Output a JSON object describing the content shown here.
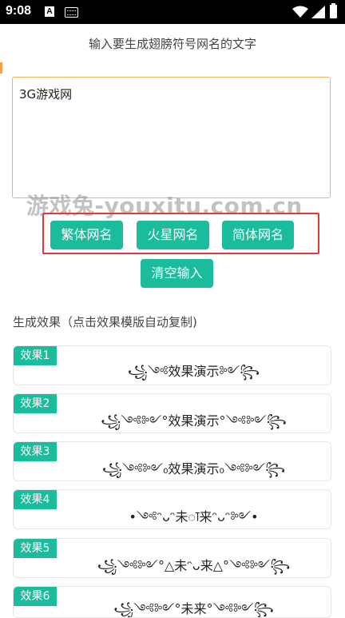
{
  "status_bar": {
    "time": "9:08",
    "icons": [
      "notification-a-icon",
      "keyboard-icon",
      "wifi-icon",
      "signal-icon",
      "battery-icon"
    ],
    "icon_a_glyph": "A"
  },
  "prompt": "输入要生成翅膀符号网名的文字",
  "input": {
    "value": "3G游戏网"
  },
  "watermark": "游戏兔-youxitu.com.cn",
  "buttons": {
    "traditional": "繁体网名",
    "martian": "火星网名",
    "simplified": "简体网名",
    "clear": "清空输入"
  },
  "section_title": "生成效果（点击效果模版自动复制)",
  "results": [
    {
      "label": "效果1",
      "text": "꧁༺效果演示༻꧂"
    },
    {
      "label": "效果2",
      "text": "꧁༺༻°效果演示°༺༻꧂"
    },
    {
      "label": "效果3",
      "text": "꧁༺༻₀效果演示₀༺༻꧂"
    },
    {
      "label": "效果4",
      "text": "•༺ᵔᴗᵔ未ꠣ来ᵔᴗᵔ༻•"
    },
    {
      "label": "效果5",
      "text": "꧁༺༻°△未ᵔᴗ来△°༺༻꧂"
    },
    {
      "label": "效果6",
      "text": "꧁༺༻°未来°༺༻꧂"
    }
  ],
  "colors": {
    "accent": "#1abc9c",
    "input_border": "#f0b25a",
    "highlight_box": "#e53935"
  }
}
